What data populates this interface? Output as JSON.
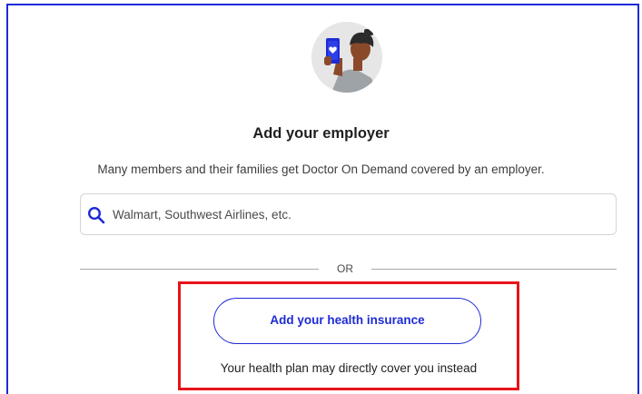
{
  "employer": {
    "title": "Add your employer",
    "subtitle": "Many members and their families get Doctor On Demand covered by an employer.",
    "search_placeholder": "Walmart, Southwest Airlines, etc."
  },
  "divider": {
    "label": "OR"
  },
  "insurance": {
    "button_label": "Add your health insurance",
    "note": "Your health plan may directly cover you instead"
  },
  "icons": {
    "illustration": "person-with-phone-heart-illustration",
    "search": "search-icon"
  },
  "colors": {
    "accent": "#1d2bd6",
    "highlight": "#e8141a",
    "avatar_background": "#e6e6e6"
  }
}
